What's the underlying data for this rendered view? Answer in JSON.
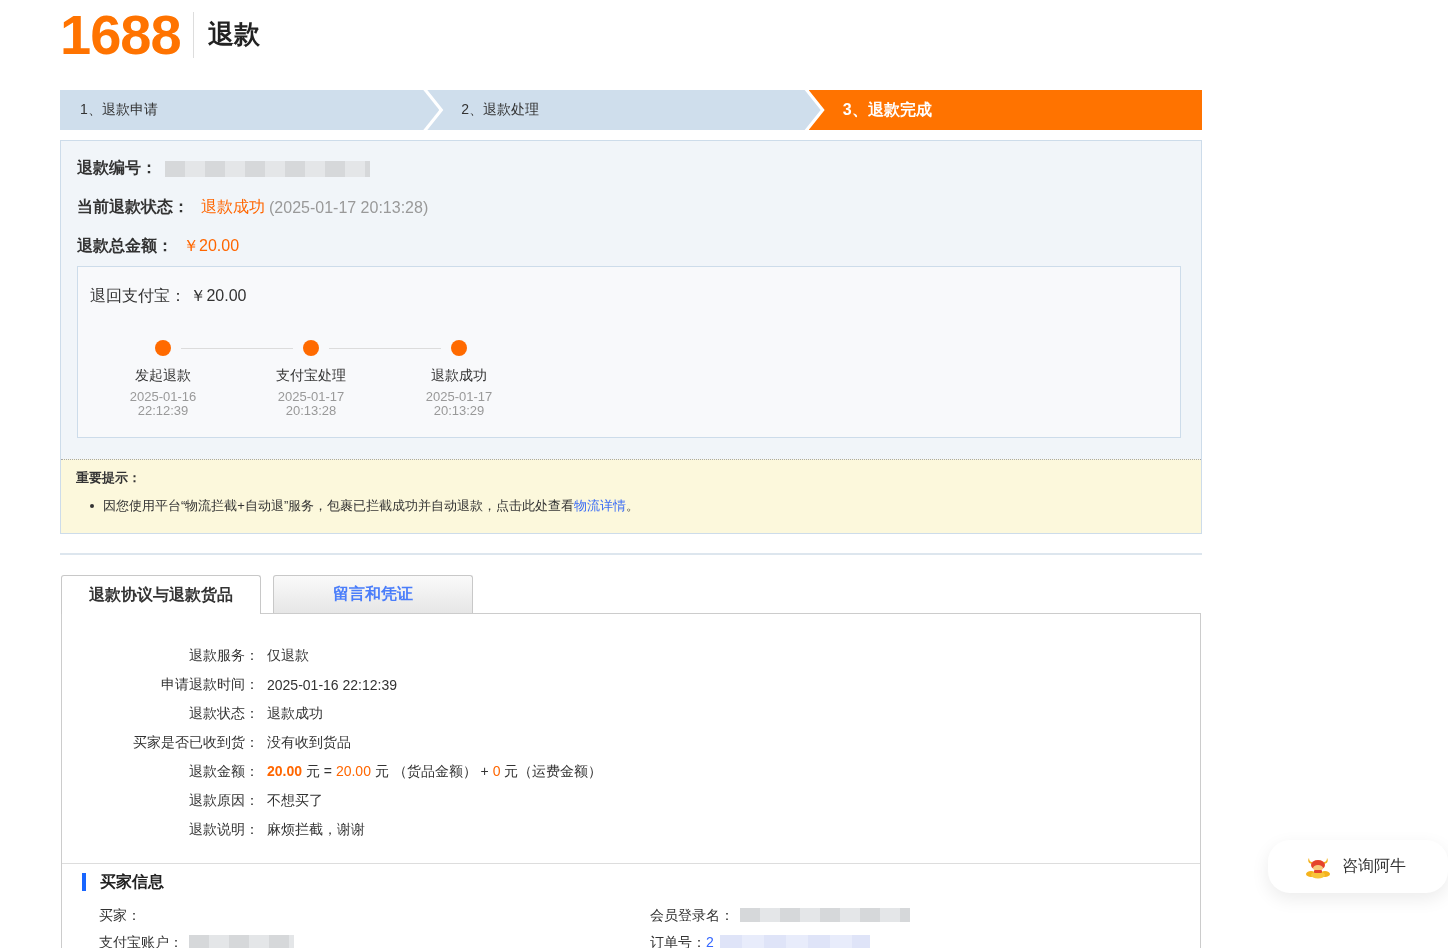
{
  "header": {
    "logo": "1688",
    "title": "退款"
  },
  "steps": [
    {
      "label": "1、退款申请",
      "selected": false
    },
    {
      "label": "2、退款处理",
      "selected": false
    },
    {
      "label": "3、退款完成",
      "selected": true
    }
  ],
  "summary": [
    {
      "kind": "redacted",
      "label": "退款编号："
    },
    {
      "kind": "status",
      "label": "当前退款状态：",
      "value": "退款成功",
      "time": "(2025-01-17 20:13:28)"
    },
    {
      "kind": "amount",
      "label": "退款总金额：",
      "value": "￥20.00"
    }
  ],
  "alipay": {
    "label": "退回支付宝：",
    "value": "￥20.00",
    "timeline": [
      {
        "label": "发起退款",
        "date": "2025-01-16",
        "time": "22:12:39",
        "done": true
      },
      {
        "label": "支付宝处理",
        "date": "2025-01-17",
        "time": "20:13:28",
        "done": true
      },
      {
        "label": "退款成功",
        "date": "2025-01-17",
        "time": "20:13:29",
        "done": true
      }
    ]
  },
  "notice": {
    "title": "重要提示：",
    "items": [
      {
        "text": "因您使用平台“物流拦截+自动退”服务，包裹已拦截成功并自动退款，点击此处查看",
        "link": "物流详情",
        "end": "。"
      }
    ]
  },
  "tabs": [
    {
      "label": "退款协议与退款货品",
      "selected": true
    },
    {
      "label": "留言和凭证",
      "selected": false
    }
  ],
  "details": [
    {
      "kind": "text",
      "label": "退款服务：",
      "value": "仅退款"
    },
    {
      "kind": "text",
      "label": "申请退款时间：",
      "value": "2025-01-16 22:12:39"
    },
    {
      "kind": "text",
      "label": "退款状态：",
      "value": "退款成功"
    },
    {
      "kind": "text",
      "label": "买家是否已收到货：",
      "value": "没有收到货品"
    },
    {
      "kind": "amount",
      "label": "退款金额：",
      "parts": [
        {
          "text": "20.00",
          "kind": "strong"
        },
        {
          "text": " 元 = ",
          "kind": "plain"
        },
        {
          "text": "20.00",
          "kind": "accent"
        },
        {
          "text": " 元 （货品金额） + ",
          "kind": "plain"
        },
        {
          "text": "0",
          "kind": "accent"
        },
        {
          "text": " 元（运费金额）",
          "kind": "plain"
        }
      ]
    },
    {
      "kind": "text",
      "label": "退款原因：",
      "value": "不想买了"
    },
    {
      "kind": "text",
      "label": "退款说明：",
      "value": "麻烦拦截，谢谢"
    }
  ],
  "buyer": {
    "title": "买家信息",
    "fields": [
      {
        "label": "买家：",
        "redacted": false
      },
      {
        "label": "会员登录名：",
        "redacted": true
      },
      {
        "label": "支付宝账户：",
        "redacted": true
      },
      {
        "label": "订单号：",
        "value": "2",
        "redacted": true
      }
    ]
  },
  "consult": {
    "label": "咨询阿牛"
  }
}
